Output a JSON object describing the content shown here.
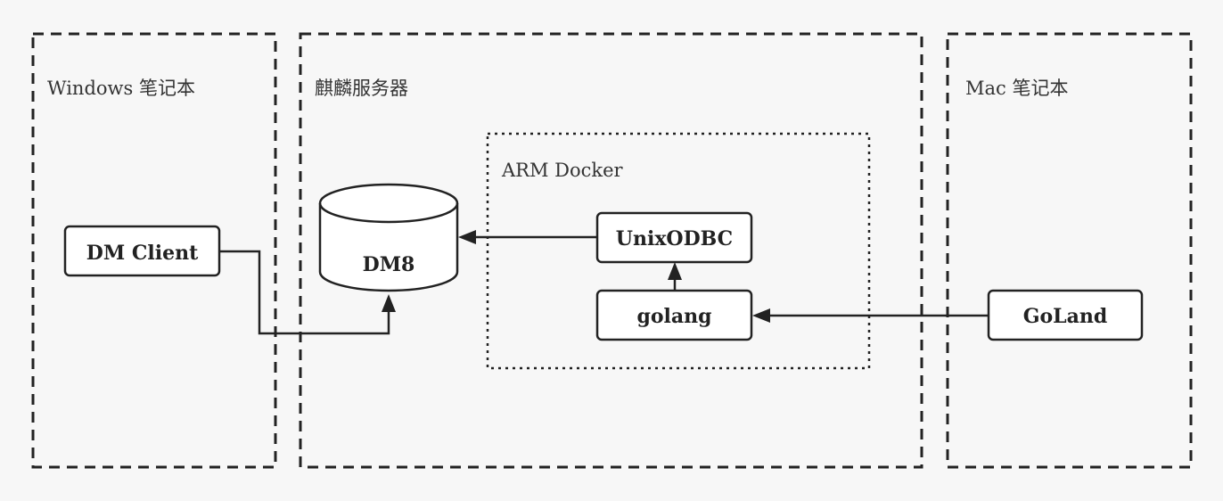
{
  "groups": {
    "windows": {
      "label": "Windows 笔记本"
    },
    "kylin": {
      "label": "麒麟服务器"
    },
    "mac": {
      "label": "Mac 笔记本"
    },
    "docker": {
      "label": "ARM Docker"
    }
  },
  "nodes": {
    "dm_client": {
      "label": "DM Client"
    },
    "dm8": {
      "label": "DM8"
    },
    "unixodbc": {
      "label": "UnixODBC"
    },
    "golang": {
      "label": "golang"
    },
    "goland": {
      "label": "GoLand"
    }
  },
  "edges": [
    {
      "from": "dm_client",
      "to": "dm8"
    },
    {
      "from": "unixodbc",
      "to": "dm8"
    },
    {
      "from": "golang",
      "to": "unixodbc"
    },
    {
      "from": "goland",
      "to": "golang"
    }
  ]
}
